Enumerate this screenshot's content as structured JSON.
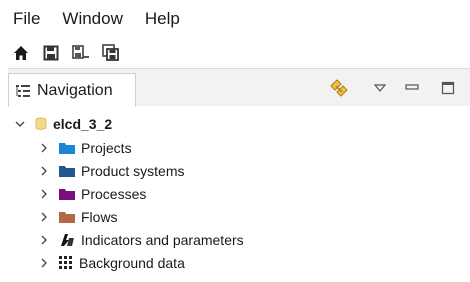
{
  "menu": {
    "items": [
      "File",
      "Window",
      "Help"
    ]
  },
  "toolbar": {
    "buttons": [
      "home-icon",
      "save-icon",
      "save-as-icon",
      "save-all-icon"
    ]
  },
  "panel": {
    "tab_label": "Navigation",
    "actions": [
      "link-with-editor-icon",
      "view-menu-icon",
      "minimize-icon",
      "maximize-icon"
    ]
  },
  "tree": {
    "root": {
      "label": "elcd_3_2",
      "expanded": true,
      "icon": "database-icon"
    },
    "children": [
      {
        "label": "Projects",
        "icon": "folder-icon",
        "color": "#1b86d6"
      },
      {
        "label": "Product systems",
        "icon": "folder-icon",
        "color": "#1f5a8e"
      },
      {
        "label": "Processes",
        "icon": "folder-icon",
        "color": "#7b0f7b"
      },
      {
        "label": "Flows",
        "icon": "folder-icon",
        "color": "#b5674a"
      },
      {
        "label": "Indicators and parameters",
        "icon": "indicators-icon"
      },
      {
        "label": "Background data",
        "icon": "grid-icon"
      }
    ]
  }
}
